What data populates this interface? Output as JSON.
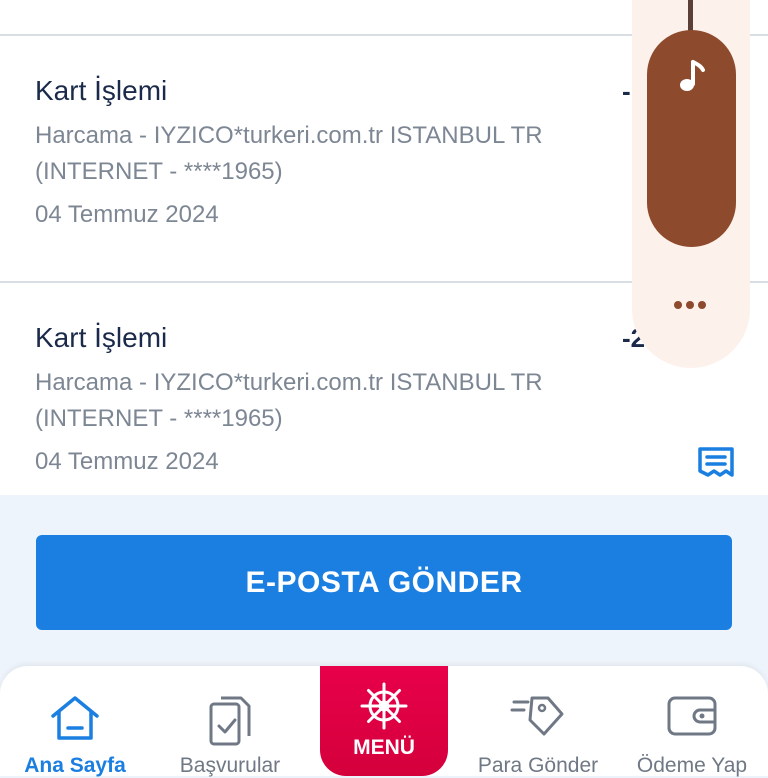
{
  "transactions": [
    {
      "title": "Kart İşlemi",
      "description": "Harcama - IYZICO*turkeri.com.tr ISTANBUL TR (INTERNET - ****1965)",
      "date": "04 Temmuz 2024",
      "amount": "-"
    },
    {
      "title": "Kart İşlemi",
      "description": "Harcama - IYZICO*turkeri.com.tr ISTANBUL TR (INTERNET - ****1965)",
      "date": "04 Temmuz 2024",
      "amount": "-2"
    }
  ],
  "email_button": {
    "label": "E-POSTA GÖNDER"
  },
  "tabbar": {
    "home": "Ana Sayfa",
    "applications": "Başvurular",
    "menu": "MENÜ",
    "send_money": "Para Gönder",
    "payment": "Ödeme Yap"
  },
  "colors": {
    "primary": "#1a7fe0",
    "menu_accent": "#e8004a",
    "overlay_pill": "#8d4a2c"
  },
  "icons": {
    "receipt": "receipt-icon",
    "home": "home-icon",
    "applications": "document-check-icon",
    "menu": "ship-wheel-icon",
    "send_money": "send-tag-icon",
    "payment": "wallet-icon",
    "music": "music-note-icon",
    "more": "more-dots-icon"
  }
}
